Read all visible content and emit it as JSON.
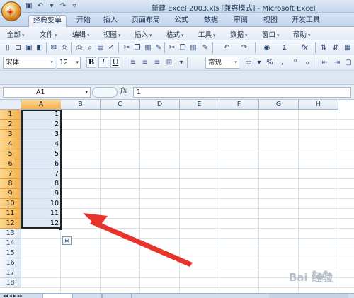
{
  "window": {
    "title": "新建 Excel 2003.xls  [兼容模式] - Microsoft Excel",
    "office_button_icon": "office-logo-icon",
    "qat_icons": [
      "save-icon",
      "undo-icon",
      "undo-dropdown-icon",
      "redo-icon",
      "customize-icon"
    ]
  },
  "ribbon": {
    "tabs": [
      "经典菜单",
      "开始",
      "插入",
      "页面布局",
      "公式",
      "数据",
      "审阅",
      "视图",
      "开发工具"
    ],
    "active_tab": "经典菜单"
  },
  "menubar": {
    "items": [
      "全部",
      "文件",
      "编辑",
      "视图",
      "插入",
      "格式",
      "工具",
      "数据",
      "窗口",
      "帮助"
    ]
  },
  "toolbar": {
    "font_name": "宋体",
    "font_size": "12",
    "bold": "B",
    "italic": "I",
    "underline": "U",
    "number_format": "常规",
    "percent": "%",
    "comma": ",",
    "sum_symbol": "Σ",
    "fx_symbol": "fx"
  },
  "formula_bar": {
    "name_box": "A1",
    "fx_label": "fx",
    "content": "1"
  },
  "sheet": {
    "columns": [
      "A",
      "B",
      "C",
      "D",
      "E",
      "F",
      "G",
      "H"
    ],
    "selected_column": "A",
    "rows": [
      "1",
      "2",
      "3",
      "4",
      "5",
      "6",
      "7",
      "8",
      "9",
      "10",
      "11",
      "12",
      "13",
      "14",
      "15",
      "16",
      "17",
      "18"
    ],
    "selected_rows": 12,
    "column_a_values": [
      "1",
      "2",
      "3",
      "4",
      "5",
      "6",
      "7",
      "8",
      "9",
      "10",
      "11",
      "12"
    ],
    "selection": "A1:A12"
  },
  "annotation": {
    "type": "red-arrow",
    "color": "#e8352c",
    "points_to": "selected column A values"
  },
  "watermark": {
    "text": "Bai 经验"
  },
  "colors": {
    "selection_fill": "#c7d6ee",
    "header_highlight": "#f5b150",
    "ribbon_bg": "#c3d5ec"
  }
}
